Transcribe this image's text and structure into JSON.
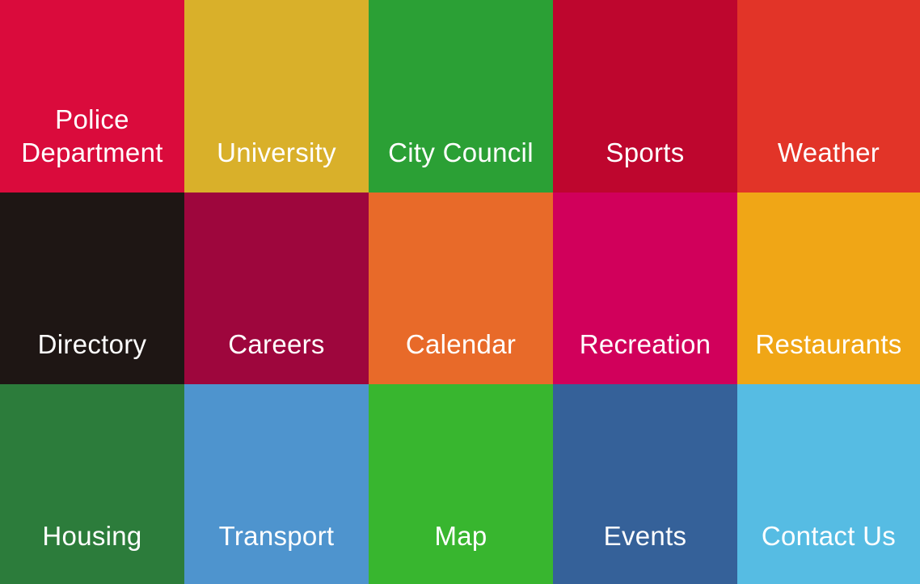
{
  "tiles": [
    {
      "label": "Police\nDepartment",
      "color": "#DA0B3C",
      "icon": "police-department"
    },
    {
      "label": "University",
      "color": "#D9B02A",
      "icon": "university"
    },
    {
      "label": "City Council",
      "color": "#2BA035",
      "icon": "city-council"
    },
    {
      "label": "Sports",
      "color": "#BE062E",
      "icon": "sports"
    },
    {
      "label": "Weather",
      "color": "#E23428",
      "icon": "weather"
    },
    {
      "label": "Directory",
      "color": "#1E1614",
      "icon": "directory"
    },
    {
      "label": "Careers",
      "color": "#9E063D",
      "icon": "careers"
    },
    {
      "label": "Calendar",
      "color": "#E86A29",
      "icon": "calendar"
    },
    {
      "label": "Recreation",
      "color": "#D1005B",
      "icon": "recreation"
    },
    {
      "label": "Restaurants",
      "color": "#F0A616",
      "icon": "restaurants"
    },
    {
      "label": "Housing",
      "color": "#2C7C3B",
      "icon": "housing"
    },
    {
      "label": "Transport",
      "color": "#4E94CE",
      "icon": "transport"
    },
    {
      "label": "Map",
      "color": "#38B62F",
      "icon": "map"
    },
    {
      "label": "Events",
      "color": "#356199",
      "icon": "events"
    },
    {
      "label": "Contact Us",
      "color": "#56BCE3",
      "icon": "contact-us"
    }
  ]
}
